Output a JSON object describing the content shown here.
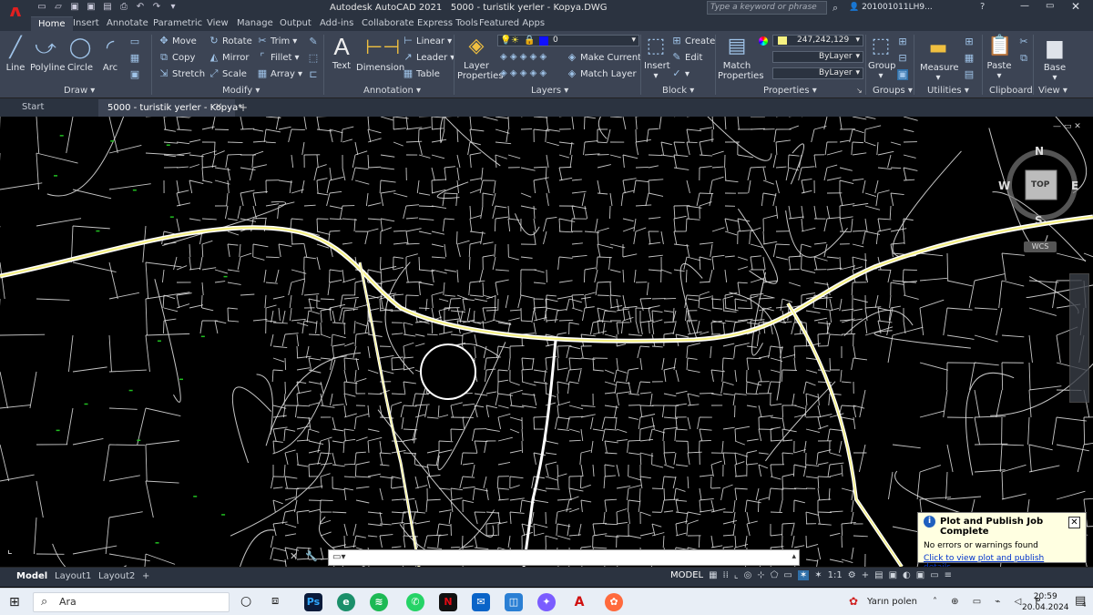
{
  "title_bar": {
    "app_name": "Autodesk AutoCAD 2021",
    "document": "5000 - turistik yerler - Kopya.DWG",
    "search_placeholder": "Type a keyword or phrase",
    "user": "201001011LH9..."
  },
  "ribbon_tabs": [
    "Home",
    "Insert",
    "Annotate",
    "Parametric",
    "View",
    "Manage",
    "Output",
    "Add-ins",
    "Collaborate",
    "Express Tools",
    "Featured Apps"
  ],
  "ribbon": {
    "draw": {
      "title": "Draw",
      "line": "Line",
      "polyline": "Polyline",
      "circle": "Circle",
      "arc": "Arc"
    },
    "modify": {
      "title": "Modify",
      "move": "Move",
      "rotate": "Rotate",
      "trim": "Trim",
      "copy": "Copy",
      "mirror": "Mirror",
      "fillet": "Fillet",
      "stretch": "Stretch",
      "scale": "Scale",
      "array": "Array"
    },
    "annotation": {
      "title": "Annotation",
      "text": "Text",
      "dimension": "Dimension",
      "linear": "Linear",
      "leader": "Leader",
      "table": "Table"
    },
    "layers": {
      "title": "Layers",
      "layer_properties_1": "Layer",
      "layer_properties_2": "Properties",
      "current_layer": "0",
      "make_current": "Make Current",
      "match_layer": "Match Layer"
    },
    "block": {
      "title": "Block",
      "insert": "Insert",
      "create": "Create",
      "edit": "Edit"
    },
    "properties": {
      "title": "Properties",
      "match_1": "Match",
      "match_2": "Properties",
      "color": "247,242,129",
      "linetype": "ByLayer",
      "lineweight": "ByLayer"
    },
    "groups": {
      "title": "Groups",
      "group": "Group"
    },
    "utilities": {
      "title": "Utilities",
      "measure": "Measure"
    },
    "clipboard": {
      "title": "Clipboard",
      "paste": "Paste"
    },
    "view": {
      "title": "View",
      "base": "Base"
    }
  },
  "doc_tabs": {
    "start": "Start",
    "active": "5000 - turistik yerler - Kopya*"
  },
  "viewcube": {
    "n": "N",
    "s": "S",
    "w": "W",
    "e": "E",
    "top": "TOP",
    "wcs": "WCS"
  },
  "layout_tabs": {
    "model": "Model",
    "layout1": "Layout1",
    "layout2": "Layout2"
  },
  "status": {
    "model": "MODEL",
    "scale": "1:1"
  },
  "notification": {
    "title": "Plot and Publish Job Complete",
    "message": "No errors or warnings found",
    "link": "Click to view plot and publish details..."
  },
  "taskbar": {
    "search": "Ara",
    "weather": "Yarın polen",
    "time": "20:59",
    "date": "20.04.2024",
    "notif_count": "4"
  },
  "colors": {
    "accent": "#e02020",
    "ribbon_bg": "#3c4454",
    "titlebar_bg": "#2b3340",
    "road_highlight": "#f5f081"
  }
}
